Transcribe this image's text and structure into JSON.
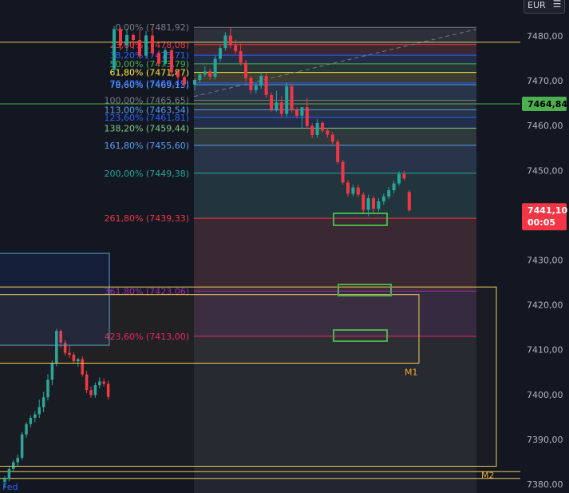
{
  "toolbar": {
    "currency": "EUR",
    "menu_icon": "hamburger-menu-icon"
  },
  "colors": {
    "background": "#131722",
    "up": "#26a69a",
    "down": "#f23645",
    "axis_text": "#b2b5be",
    "box": "#f0cc5a",
    "current_price_badge": "#f23645",
    "line_price_badge": "#4caf50"
  },
  "chart_data": {
    "type": "candlestick",
    "y_axis": {
      "range": [
        7378.5,
        7486.5
      ],
      "ticks": [
        "7480,00",
        "7470,00",
        "7460,00",
        "7450,00",
        "7440,00",
        "7430,00",
        "7420,00",
        "7410,00",
        "7400,00",
        "7390,00",
        "7380,00"
      ],
      "tick_values": [
        7480,
        7470,
        7460,
        7450,
        7440,
        7430,
        7420,
        7410,
        7400,
        7390,
        7380
      ]
    },
    "price_badges": [
      {
        "name": "horizontal-line-price",
        "value": 7464.84,
        "label": "7464,84",
        "color": "#4caf50"
      },
      {
        "name": "current-price",
        "value": 7441.1,
        "label": "7441,10",
        "sublabel": "00:05",
        "color": "#f23645"
      }
    ],
    "horizontal_lines": [
      {
        "value": 7478.6,
        "color": "#f0cc5a"
      },
      {
        "value": 7464.84,
        "color": "#4caf50"
      },
      {
        "value": 7382.8,
        "color": "#f0cc5a"
      },
      {
        "value": 7381.3,
        "color": "#f0cc5a"
      }
    ],
    "fibonacci": {
      "levels": [
        {
          "ratio": "0,00%",
          "price": "7481,92",
          "value": 7481.92,
          "color": "#787b86"
        },
        {
          "ratio": "23,60%",
          "price": "7478,08",
          "value": 7478.08,
          "color": "#f23645"
        },
        {
          "ratio": "38,20%",
          "price": "7475,71",
          "value": 7475.71,
          "color": "#2962ff"
        },
        {
          "ratio": "50,00%",
          "price": "7473,79",
          "value": 7473.79,
          "color": "#4caf50"
        },
        {
          "ratio": "61,80%",
          "price": "7471,87",
          "value": 7471.87,
          "color": "#ffeb3b"
        },
        {
          "ratio": "76,40%",
          "price": "7469,49",
          "value": 7469.49,
          "color": "#2962ff"
        },
        {
          "ratio": "78,60%",
          "price": "7469,13",
          "value": 7469.13,
          "color": "#5b9cf6"
        },
        {
          "ratio": "100,00%",
          "price": "7465,65",
          "value": 7465.65,
          "color": "#787b86"
        },
        {
          "ratio": "113,00%",
          "price": "7463,54",
          "value": 7463.54,
          "color": "#5b9cf6"
        },
        {
          "ratio": "123,60%",
          "price": "7461,81",
          "value": 7461.81,
          "color": "#2962ff"
        },
        {
          "ratio": "138,20%",
          "price": "7459,44",
          "value": 7459.44,
          "color": "#81c784"
        },
        {
          "ratio": "161,80%",
          "price": "7455,60",
          "value": 7455.6,
          "color": "#5b9cf6"
        },
        {
          "ratio": "200,00%",
          "price": "7449,38",
          "value": 7449.38,
          "color": "#26a69a"
        },
        {
          "ratio": "261,80%",
          "price": "7439,33",
          "value": 7439.33,
          "color": "#f23645"
        },
        {
          "ratio": "361,80%",
          "price": "7423,06",
          "value": 7423.06,
          "color": "#9c27b0"
        },
        {
          "ratio": "423,60%",
          "price": "7413,00",
          "value": 7413.0,
          "color": "#e91e63"
        }
      ]
    },
    "zones": [
      {
        "label": "M1",
        "top": 7422.3,
        "bottom": 7407.0,
        "color": "#f0cc5a"
      },
      {
        "label": "M2",
        "top": 7424.0,
        "bottom": 7384.0,
        "color": "#f0cc5a"
      }
    ],
    "event_marker": {
      "label": "Fed"
    },
    "candles_left": [
      {
        "o": 7380.5,
        "h": 7381.8,
        "l": 7379.2,
        "c": 7381.2
      },
      {
        "o": 7381.2,
        "h": 7383.8,
        "l": 7380.6,
        "c": 7383.4
      },
      {
        "o": 7383.4,
        "h": 7385.4,
        "l": 7382.8,
        "c": 7384.9
      },
      {
        "o": 7384.9,
        "h": 7386.6,
        "l": 7383.9,
        "c": 7385.9
      },
      {
        "o": 7385.9,
        "h": 7391.6,
        "l": 7385.4,
        "c": 7391.1
      },
      {
        "o": 7391.1,
        "h": 7393.9,
        "l": 7390.4,
        "c": 7393.4
      },
      {
        "o": 7393.4,
        "h": 7395.4,
        "l": 7392.7,
        "c": 7394.8
      },
      {
        "o": 7394.8,
        "h": 7396.3,
        "l": 7393.8,
        "c": 7395.6
      },
      {
        "o": 7395.6,
        "h": 7398.9,
        "l": 7394.8,
        "c": 7397.2
      },
      {
        "o": 7397.2,
        "h": 7400.6,
        "l": 7396.1,
        "c": 7399.4
      },
      {
        "o": 7399.4,
        "h": 7404.6,
        "l": 7398.7,
        "c": 7403.3
      },
      {
        "o": 7403.3,
        "h": 7407.6,
        "l": 7402.1,
        "c": 7406.9
      },
      {
        "o": 7406.9,
        "h": 7414.7,
        "l": 7406.3,
        "c": 7414.2
      },
      {
        "o": 7414.2,
        "h": 7414.5,
        "l": 7410.4,
        "c": 7411.6
      },
      {
        "o": 7411.6,
        "h": 7412.2,
        "l": 7408.7,
        "c": 7409.3
      },
      {
        "o": 7409.3,
        "h": 7410.8,
        "l": 7408.2,
        "c": 7408.9
      },
      {
        "o": 7408.9,
        "h": 7409.4,
        "l": 7406.9,
        "c": 7407.4
      },
      {
        "o": 7407.4,
        "h": 7408.2,
        "l": 7406.2,
        "c": 7407.9
      },
      {
        "o": 7407.9,
        "h": 7408.5,
        "l": 7404.0,
        "c": 7404.5
      },
      {
        "o": 7404.5,
        "h": 7405.3,
        "l": 7400.3,
        "c": 7401.0
      },
      {
        "o": 7401.0,
        "h": 7401.8,
        "l": 7399.3,
        "c": 7399.9
      },
      {
        "o": 7399.9,
        "h": 7402.7,
        "l": 7399.3,
        "c": 7402.1
      },
      {
        "o": 7402.1,
        "h": 7403.8,
        "l": 7401.4,
        "c": 7402.9
      },
      {
        "o": 7402.9,
        "h": 7403.6,
        "l": 7401.8,
        "c": 7402.4
      },
      {
        "o": 7402.4,
        "h": 7403.1,
        "l": 7398.9,
        "c": 7399.5
      }
    ],
    "candles_top": [
      {
        "o": 7472.5,
        "h": 7482.2,
        "l": 7471.6,
        "c": 7481.5
      },
      {
        "o": 7481.5,
        "h": 7481.9,
        "l": 7476.8,
        "c": 7477.9
      },
      {
        "o": 7477.9,
        "h": 7481.6,
        "l": 7476.6,
        "c": 7480.2
      },
      {
        "o": 7480.2,
        "h": 7480.6,
        "l": 7477.1,
        "c": 7479.1
      },
      {
        "o": 7479.1,
        "h": 7481.4,
        "l": 7474.9,
        "c": 7475.6
      },
      {
        "o": 7475.6,
        "h": 7481.1,
        "l": 7474.9,
        "c": 7480.1
      },
      {
        "o": 7480.1,
        "h": 7481.9,
        "l": 7475.5,
        "c": 7476.2
      },
      {
        "o": 7476.2,
        "h": 7476.8,
        "l": 7473.1,
        "c": 7473.8
      },
      {
        "o": 7473.8,
        "h": 7477.5,
        "l": 7473.2,
        "c": 7476.8
      },
      {
        "o": 7476.8,
        "h": 7477.2,
        "l": 7470.9,
        "c": 7471.9
      },
      {
        "o": 7471.9,
        "h": 7472.6,
        "l": 7470.1,
        "c": 7470.8
      },
      {
        "o": 7470.8,
        "h": 7471.2,
        "l": 7468.6,
        "c": 7469.2
      }
    ],
    "candles_main": [
      {
        "o": 7469.2,
        "h": 7470.4,
        "l": 7467.9,
        "c": 7470.2
      },
      {
        "o": 7470.2,
        "h": 7471.8,
        "l": 7469.6,
        "c": 7471.4
      },
      {
        "o": 7471.4,
        "h": 7473.2,
        "l": 7470.8,
        "c": 7472.1
      },
      {
        "o": 7472.1,
        "h": 7472.7,
        "l": 7470.2,
        "c": 7470.9
      },
      {
        "o": 7470.9,
        "h": 7475.6,
        "l": 7470.3,
        "c": 7474.9
      },
      {
        "o": 7474.9,
        "h": 7477.9,
        "l": 7474.2,
        "c": 7477.3
      },
      {
        "o": 7477.3,
        "h": 7480.8,
        "l": 7476.7,
        "c": 7480.1
      },
      {
        "o": 7480.1,
        "h": 7481.9,
        "l": 7477.2,
        "c": 7477.9
      },
      {
        "o": 7477.9,
        "h": 7479.2,
        "l": 7476.1,
        "c": 7476.6
      },
      {
        "o": 7476.6,
        "h": 7478.3,
        "l": 7473.4,
        "c": 7474.0
      },
      {
        "o": 7474.0,
        "h": 7474.6,
        "l": 7469.8,
        "c": 7470.6
      },
      {
        "o": 7470.6,
        "h": 7471.1,
        "l": 7467.2,
        "c": 7467.9
      },
      {
        "o": 7467.9,
        "h": 7469.6,
        "l": 7467.2,
        "c": 7468.9
      },
      {
        "o": 7468.9,
        "h": 7471.9,
        "l": 7468.2,
        "c": 7471.1
      },
      {
        "o": 7471.1,
        "h": 7471.8,
        "l": 7466.2,
        "c": 7466.8
      },
      {
        "o": 7466.8,
        "h": 7467.4,
        "l": 7463.1,
        "c": 7463.6
      },
      {
        "o": 7463.6,
        "h": 7467.7,
        "l": 7463.0,
        "c": 7465.2
      },
      {
        "o": 7465.2,
        "h": 7466.6,
        "l": 7461.8,
        "c": 7462.6
      },
      {
        "o": 7462.6,
        "h": 7469.6,
        "l": 7462.0,
        "c": 7468.8
      },
      {
        "o": 7468.8,
        "h": 7469.3,
        "l": 7462.9,
        "c": 7463.5
      },
      {
        "o": 7463.5,
        "h": 7464.1,
        "l": 7461.6,
        "c": 7462.2
      },
      {
        "o": 7462.2,
        "h": 7463.0,
        "l": 7459.4,
        "c": 7464.1
      },
      {
        "o": 7464.1,
        "h": 7466.1,
        "l": 7459.2,
        "c": 7459.9
      },
      {
        "o": 7459.9,
        "h": 7460.5,
        "l": 7457.2,
        "c": 7457.9
      },
      {
        "o": 7457.9,
        "h": 7461.4,
        "l": 7457.3,
        "c": 7460.6
      },
      {
        "o": 7460.6,
        "h": 7461.0,
        "l": 7458.4,
        "c": 7458.9
      },
      {
        "o": 7458.9,
        "h": 7459.5,
        "l": 7457.3,
        "c": 7458.0
      },
      {
        "o": 7458.0,
        "h": 7458.6,
        "l": 7455.8,
        "c": 7456.4
      },
      {
        "o": 7456.4,
        "h": 7456.9,
        "l": 7451.4,
        "c": 7451.9
      },
      {
        "o": 7451.9,
        "h": 7452.4,
        "l": 7446.8,
        "c": 7447.3
      },
      {
        "o": 7447.3,
        "h": 7447.9,
        "l": 7444.2,
        "c": 7444.8
      },
      {
        "o": 7444.8,
        "h": 7446.8,
        "l": 7444.2,
        "c": 7446.2
      },
      {
        "o": 7446.2,
        "h": 7446.8,
        "l": 7444.0,
        "c": 7444.6
      },
      {
        "o": 7444.6,
        "h": 7445.1,
        "l": 7440.6,
        "c": 7441.2
      },
      {
        "o": 7441.2,
        "h": 7444.6,
        "l": 7439.8,
        "c": 7443.8
      },
      {
        "o": 7443.8,
        "h": 7444.3,
        "l": 7440.6,
        "c": 7441.4
      },
      {
        "o": 7441.4,
        "h": 7443.8,
        "l": 7440.8,
        "c": 7443.1
      },
      {
        "o": 7443.1,
        "h": 7444.8,
        "l": 7442.3,
        "c": 7444.2
      },
      {
        "o": 7444.2,
        "h": 7446.3,
        "l": 7443.6,
        "c": 7445.6
      },
      {
        "o": 7445.6,
        "h": 7447.7,
        "l": 7444.9,
        "c": 7447.1
      },
      {
        "o": 7447.1,
        "h": 7449.8,
        "l": 7446.6,
        "c": 7449.2
      },
      {
        "o": 7449.2,
        "h": 7449.9,
        "l": 7447.8,
        "c": 7448.2
      },
      {
        "o": 7445.2,
        "h": 7445.6,
        "l": 7440.8,
        "c": 7441.1
      }
    ]
  }
}
